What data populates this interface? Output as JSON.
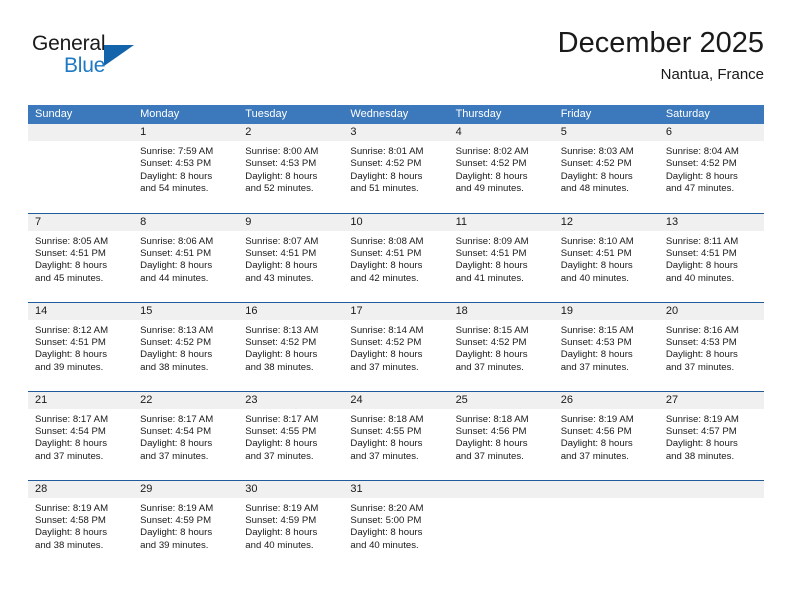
{
  "brand": {
    "word_top": "General",
    "word_bottom": "Blue",
    "accent_color": "#1464ab",
    "logo_icon": "triangle-icon"
  },
  "header": {
    "month_title": "December 2025",
    "location": "Nantua, France"
  },
  "calendar": {
    "header_bg": "#3c78bc",
    "row_divider_color": "#205a9c",
    "daynum_band_bg": "#f0f0f0",
    "weekdays": [
      "Sunday",
      "Monday",
      "Tuesday",
      "Wednesday",
      "Thursday",
      "Friday",
      "Saturday"
    ],
    "weeks": [
      [
        {
          "day": ""
        },
        {
          "day": "1",
          "sunrise": "Sunrise: 7:59 AM",
          "sunset": "Sunset: 4:53 PM",
          "daylight_1": "Daylight: 8 hours",
          "daylight_2": "and 54 minutes."
        },
        {
          "day": "2",
          "sunrise": "Sunrise: 8:00 AM",
          "sunset": "Sunset: 4:53 PM",
          "daylight_1": "Daylight: 8 hours",
          "daylight_2": "and 52 minutes."
        },
        {
          "day": "3",
          "sunrise": "Sunrise: 8:01 AM",
          "sunset": "Sunset: 4:52 PM",
          "daylight_1": "Daylight: 8 hours",
          "daylight_2": "and 51 minutes."
        },
        {
          "day": "4",
          "sunrise": "Sunrise: 8:02 AM",
          "sunset": "Sunset: 4:52 PM",
          "daylight_1": "Daylight: 8 hours",
          "daylight_2": "and 49 minutes."
        },
        {
          "day": "5",
          "sunrise": "Sunrise: 8:03 AM",
          "sunset": "Sunset: 4:52 PM",
          "daylight_1": "Daylight: 8 hours",
          "daylight_2": "and 48 minutes."
        },
        {
          "day": "6",
          "sunrise": "Sunrise: 8:04 AM",
          "sunset": "Sunset: 4:52 PM",
          "daylight_1": "Daylight: 8 hours",
          "daylight_2": "and 47 minutes."
        }
      ],
      [
        {
          "day": "7",
          "sunrise": "Sunrise: 8:05 AM",
          "sunset": "Sunset: 4:51 PM",
          "daylight_1": "Daylight: 8 hours",
          "daylight_2": "and 45 minutes."
        },
        {
          "day": "8",
          "sunrise": "Sunrise: 8:06 AM",
          "sunset": "Sunset: 4:51 PM",
          "daylight_1": "Daylight: 8 hours",
          "daylight_2": "and 44 minutes."
        },
        {
          "day": "9",
          "sunrise": "Sunrise: 8:07 AM",
          "sunset": "Sunset: 4:51 PM",
          "daylight_1": "Daylight: 8 hours",
          "daylight_2": "and 43 minutes."
        },
        {
          "day": "10",
          "sunrise": "Sunrise: 8:08 AM",
          "sunset": "Sunset: 4:51 PM",
          "daylight_1": "Daylight: 8 hours",
          "daylight_2": "and 42 minutes."
        },
        {
          "day": "11",
          "sunrise": "Sunrise: 8:09 AM",
          "sunset": "Sunset: 4:51 PM",
          "daylight_1": "Daylight: 8 hours",
          "daylight_2": "and 41 minutes."
        },
        {
          "day": "12",
          "sunrise": "Sunrise: 8:10 AM",
          "sunset": "Sunset: 4:51 PM",
          "daylight_1": "Daylight: 8 hours",
          "daylight_2": "and 40 minutes."
        },
        {
          "day": "13",
          "sunrise": "Sunrise: 8:11 AM",
          "sunset": "Sunset: 4:51 PM",
          "daylight_1": "Daylight: 8 hours",
          "daylight_2": "and 40 minutes."
        }
      ],
      [
        {
          "day": "14",
          "sunrise": "Sunrise: 8:12 AM",
          "sunset": "Sunset: 4:51 PM",
          "daylight_1": "Daylight: 8 hours",
          "daylight_2": "and 39 minutes."
        },
        {
          "day": "15",
          "sunrise": "Sunrise: 8:13 AM",
          "sunset": "Sunset: 4:52 PM",
          "daylight_1": "Daylight: 8 hours",
          "daylight_2": "and 38 minutes."
        },
        {
          "day": "16",
          "sunrise": "Sunrise: 8:13 AM",
          "sunset": "Sunset: 4:52 PM",
          "daylight_1": "Daylight: 8 hours",
          "daylight_2": "and 38 minutes."
        },
        {
          "day": "17",
          "sunrise": "Sunrise: 8:14 AM",
          "sunset": "Sunset: 4:52 PM",
          "daylight_1": "Daylight: 8 hours",
          "daylight_2": "and 37 minutes."
        },
        {
          "day": "18",
          "sunrise": "Sunrise: 8:15 AM",
          "sunset": "Sunset: 4:52 PM",
          "daylight_1": "Daylight: 8 hours",
          "daylight_2": "and 37 minutes."
        },
        {
          "day": "19",
          "sunrise": "Sunrise: 8:15 AM",
          "sunset": "Sunset: 4:53 PM",
          "daylight_1": "Daylight: 8 hours",
          "daylight_2": "and 37 minutes."
        },
        {
          "day": "20",
          "sunrise": "Sunrise: 8:16 AM",
          "sunset": "Sunset: 4:53 PM",
          "daylight_1": "Daylight: 8 hours",
          "daylight_2": "and 37 minutes."
        }
      ],
      [
        {
          "day": "21",
          "sunrise": "Sunrise: 8:17 AM",
          "sunset": "Sunset: 4:54 PM",
          "daylight_1": "Daylight: 8 hours",
          "daylight_2": "and 37 minutes."
        },
        {
          "day": "22",
          "sunrise": "Sunrise: 8:17 AM",
          "sunset": "Sunset: 4:54 PM",
          "daylight_1": "Daylight: 8 hours",
          "daylight_2": "and 37 minutes."
        },
        {
          "day": "23",
          "sunrise": "Sunrise: 8:17 AM",
          "sunset": "Sunset: 4:55 PM",
          "daylight_1": "Daylight: 8 hours",
          "daylight_2": "and 37 minutes."
        },
        {
          "day": "24",
          "sunrise": "Sunrise: 8:18 AM",
          "sunset": "Sunset: 4:55 PM",
          "daylight_1": "Daylight: 8 hours",
          "daylight_2": "and 37 minutes."
        },
        {
          "day": "25",
          "sunrise": "Sunrise: 8:18 AM",
          "sunset": "Sunset: 4:56 PM",
          "daylight_1": "Daylight: 8 hours",
          "daylight_2": "and 37 minutes."
        },
        {
          "day": "26",
          "sunrise": "Sunrise: 8:19 AM",
          "sunset": "Sunset: 4:56 PM",
          "daylight_1": "Daylight: 8 hours",
          "daylight_2": "and 37 minutes."
        },
        {
          "day": "27",
          "sunrise": "Sunrise: 8:19 AM",
          "sunset": "Sunset: 4:57 PM",
          "daylight_1": "Daylight: 8 hours",
          "daylight_2": "and 38 minutes."
        }
      ],
      [
        {
          "day": "28",
          "sunrise": "Sunrise: 8:19 AM",
          "sunset": "Sunset: 4:58 PM",
          "daylight_1": "Daylight: 8 hours",
          "daylight_2": "and 38 minutes."
        },
        {
          "day": "29",
          "sunrise": "Sunrise: 8:19 AM",
          "sunset": "Sunset: 4:59 PM",
          "daylight_1": "Daylight: 8 hours",
          "daylight_2": "and 39 minutes."
        },
        {
          "day": "30",
          "sunrise": "Sunrise: 8:19 AM",
          "sunset": "Sunset: 4:59 PM",
          "daylight_1": "Daylight: 8 hours",
          "daylight_2": "and 40 minutes."
        },
        {
          "day": "31",
          "sunrise": "Sunrise: 8:20 AM",
          "sunset": "Sunset: 5:00 PM",
          "daylight_1": "Daylight: 8 hours",
          "daylight_2": "and 40 minutes."
        },
        {
          "day": ""
        },
        {
          "day": ""
        },
        {
          "day": ""
        }
      ]
    ]
  }
}
